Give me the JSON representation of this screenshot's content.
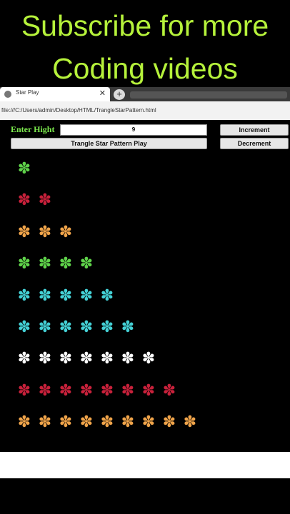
{
  "banner": {
    "line1": "Subscribe for more",
    "line2": "Coding videos"
  },
  "browser": {
    "tab_title": "Star Play",
    "tab_close": "✕",
    "new_tab": "+",
    "url": "file:///C:/Users/admin/Desktop/HTML/TrangleStarPattern.html"
  },
  "form": {
    "label": "Enter Hight",
    "height_value": "9",
    "increment_label": "Increment",
    "decrement_label": "Decrement",
    "play_label": "Trangle Star Pattern Play"
  },
  "pattern": {
    "glyph": "✽",
    "rows": [
      {
        "count": 1,
        "color": "#5fd24a"
      },
      {
        "count": 2,
        "color": "#c8213b"
      },
      {
        "count": 3,
        "color": "#f0a44a"
      },
      {
        "count": 4,
        "color": "#5fd24a"
      },
      {
        "count": 5,
        "color": "#44d1d6"
      },
      {
        "count": 6,
        "color": "#44d1d6"
      },
      {
        "count": 7,
        "color": "#ffffff"
      },
      {
        "count": 8,
        "color": "#c8213b"
      },
      {
        "count": 9,
        "color": "#f0a44a"
      }
    ]
  }
}
